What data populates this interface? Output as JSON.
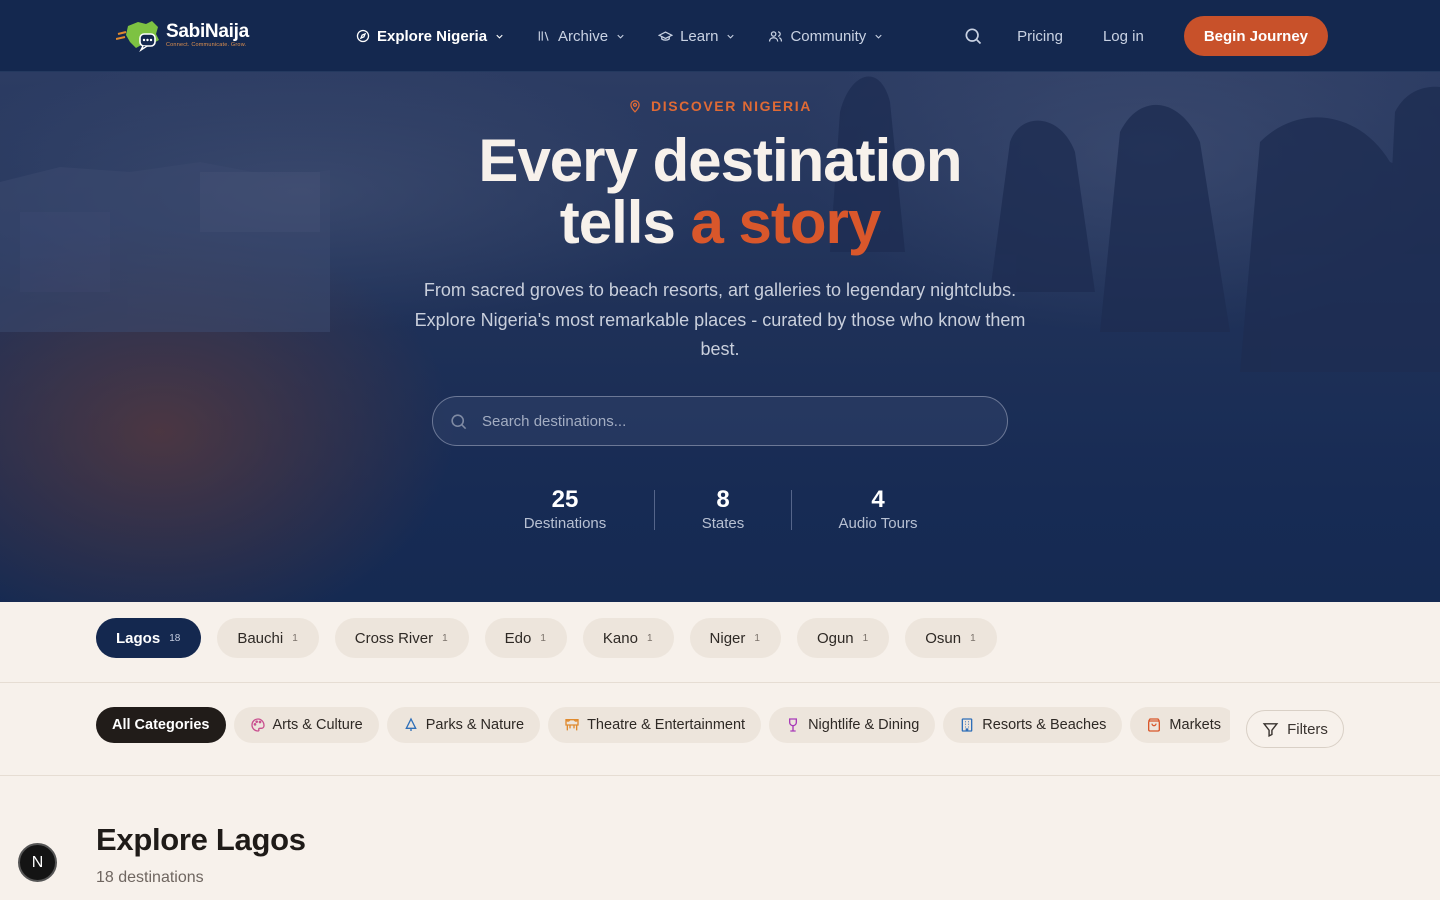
{
  "brand": {
    "name": "SabiNaija",
    "tagline": "Connect. Communicate. Grow."
  },
  "nav": {
    "menu": [
      {
        "label": "Explore Nigeria",
        "icon": "compass-icon",
        "active": true
      },
      {
        "label": "Archive",
        "icon": "library-icon",
        "active": false
      },
      {
        "label": "Learn",
        "icon": "graduation-cap-icon",
        "active": false
      },
      {
        "label": "Community",
        "icon": "users-icon",
        "active": false
      }
    ],
    "pricing_label": "Pricing",
    "login_label": "Log in",
    "cta_label": "Begin Journey"
  },
  "hero": {
    "eyebrow": "DISCOVER NIGERIA",
    "headline_line1": "Every destination",
    "headline_line2_plain": "tells ",
    "headline_line2_accent": "a story",
    "subtitle": "From sacred groves to beach resorts, art galleries to legendary nightclubs. Explore Nigeria's most remarkable places - curated by those who know them best.",
    "search_placeholder": "Search destinations...",
    "stats": [
      {
        "value": "25",
        "label": "Destinations"
      },
      {
        "value": "8",
        "label": "States"
      },
      {
        "value": "4",
        "label": "Audio Tours"
      }
    ]
  },
  "states": [
    {
      "name": "Lagos",
      "count": "18",
      "active": true
    },
    {
      "name": "Bauchi",
      "count": "1",
      "active": false
    },
    {
      "name": "Cross River",
      "count": "1",
      "active": false
    },
    {
      "name": "Edo",
      "count": "1",
      "active": false
    },
    {
      "name": "Kano",
      "count": "1",
      "active": false
    },
    {
      "name": "Niger",
      "count": "1",
      "active": false
    },
    {
      "name": "Ogun",
      "count": "1",
      "active": false
    },
    {
      "name": "Osun",
      "count": "1",
      "active": false
    }
  ],
  "categories": [
    {
      "label": "All Categories",
      "icon": "",
      "active": true
    },
    {
      "label": "Arts & Culture",
      "icon": "palette-icon",
      "color": "#c94f8f"
    },
    {
      "label": "Parks & Nature",
      "icon": "tree-icon",
      "color": "#2f6fb8"
    },
    {
      "label": "Theatre & Entertainment",
      "icon": "theatre-icon",
      "color": "#e08a2e"
    },
    {
      "label": "Nightlife & Dining",
      "icon": "wine-glass-icon",
      "color": "#a83ab8"
    },
    {
      "label": "Resorts & Beaches",
      "icon": "hotel-icon",
      "color": "#2f6fb8"
    },
    {
      "label": "Markets",
      "icon": "shopping-bag-icon",
      "color": "#d9572b"
    }
  ],
  "filters_label": "Filters",
  "section": {
    "title": "Explore Lagos",
    "count_text": "18 destinations"
  },
  "badge_letter": "N",
  "colors": {
    "navy": "#14284f",
    "accent": "#d9572b",
    "cream": "#f7f1eb"
  }
}
